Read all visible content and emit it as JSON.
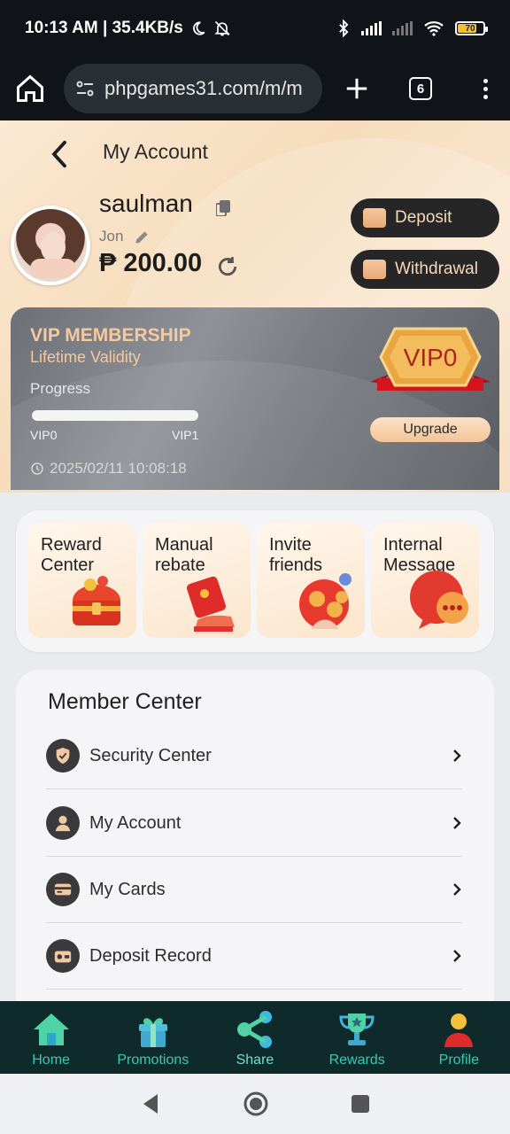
{
  "status_bar": {
    "time_speed": "10:13 AM | 35.4KB/s",
    "battery": "70"
  },
  "browser": {
    "url": "phpgames31.com/m/m",
    "tab_count": "6"
  },
  "page": {
    "title": "My Account"
  },
  "profile": {
    "username": "saulman",
    "nickname": "Jon",
    "balance": "₱ 200.00",
    "deposit_label": "Deposit",
    "withdraw_label": "Withdrawal"
  },
  "vip": {
    "title": "VIP MEMBERSHIP",
    "subtitle": "Lifetime Validity",
    "progress_label": "Progress",
    "progress_fraction": 0,
    "level_from": "VIP0",
    "level_to": "VIP1",
    "timestamp": "2025/02/11 10:08:18",
    "badge": "VIP0",
    "upgrade_label": "Upgrade"
  },
  "tiles": [
    {
      "label": "Reward Center",
      "icon": "treasure-chest-icon"
    },
    {
      "label": "Manual rebate",
      "icon": "red-envelope-icon"
    },
    {
      "label": "Invite friends",
      "icon": "invite-icon"
    },
    {
      "label": "Internal Message",
      "icon": "chat-bubble-icon"
    }
  ],
  "member_center": {
    "title": "Member Center",
    "items": [
      {
        "label": "Security Center",
        "icon": "shield-icon"
      },
      {
        "label": "My Account",
        "icon": "user-icon"
      },
      {
        "label": "My Cards",
        "icon": "card-icon"
      },
      {
        "label": "Deposit Record",
        "icon": "wallet-icon"
      }
    ]
  },
  "bottom_nav": [
    {
      "label": "Home",
      "icon": "home-icon"
    },
    {
      "label": "Promotions",
      "icon": "gift-icon"
    },
    {
      "label": "Share",
      "icon": "share-icon"
    },
    {
      "label": "Rewards",
      "icon": "trophy-icon"
    },
    {
      "label": "Profile",
      "icon": "person-icon"
    }
  ],
  "colors": {
    "accent_teal": "#3cc8b3",
    "vip_gold": "#f3c9a0",
    "dark_button": "#262626"
  }
}
